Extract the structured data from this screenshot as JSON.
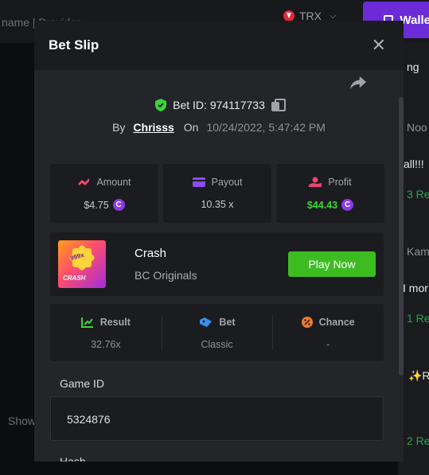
{
  "background": {
    "search_text": "name | Provider",
    "currency": "TRX",
    "wallet_label": "Wallet",
    "show_text": "Show",
    "chat_fragments": [
      "ng",
      "Noo",
      "all!!!",
      "3 Re",
      "Kam",
      "I mor",
      "1 Re",
      "✨Re",
      "2 Re"
    ]
  },
  "modal": {
    "title": "Bet Slip",
    "bet_id_label": "Bet ID:",
    "bet_id": "974117733",
    "by_label": "By",
    "username": "Chrisss",
    "on_label": "On",
    "datetime": "10/24/2022, 5:47:42 PM",
    "stats": {
      "amount_label": "Amount",
      "amount_value": "$4.75",
      "payout_label": "Payout",
      "payout_value": "10.35 x",
      "profit_label": "Profit",
      "profit_value": "$44.43"
    },
    "game": {
      "name": "Crash",
      "provider": "BC Originals",
      "thumb_multiplier": "999x",
      "thumb_title": "CRASH",
      "play_button": "Play Now"
    },
    "details": {
      "result_label": "Result",
      "result_value": "32.76x",
      "bet_label": "Bet",
      "bet_value": "Classic",
      "chance_label": "Chance",
      "chance_value": "-"
    },
    "game_id_label": "Game ID",
    "game_id_value": "5324876",
    "hash_label": "Hash"
  },
  "colors": {
    "accent_green": "#3dbc22",
    "profit_green": "#3cd43b",
    "coin_purple": "#8c39e6",
    "wallet_purple": "#6b2bd6",
    "modal_bg": "#232529"
  }
}
